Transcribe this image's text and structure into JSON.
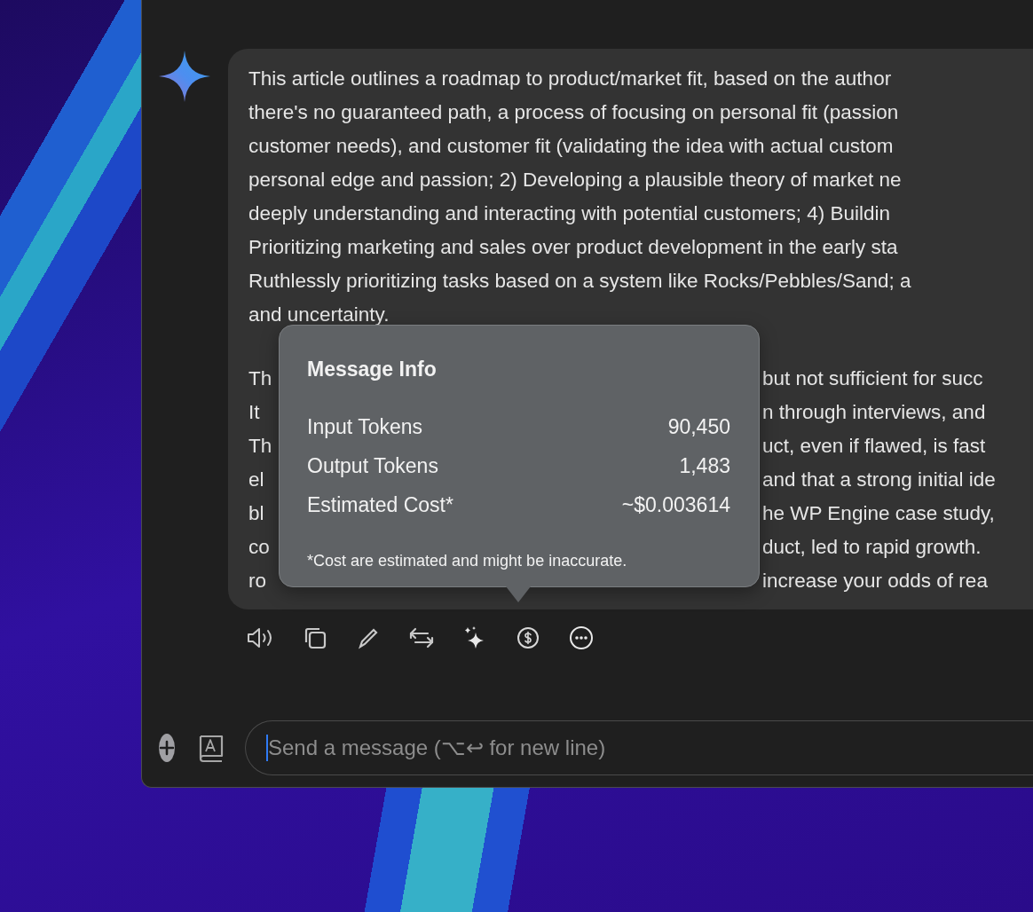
{
  "message": {
    "paragraphs": [
      {
        "lines": [
          {
            "text": "This article outlines a roadmap to product/market fit, based on the author"
          },
          {
            "text": "there's no guaranteed path, a process of focusing on personal fit (passion"
          },
          {
            "text": "customer needs), and customer fit (validating the idea with actual custom"
          },
          {
            "text": "personal edge and passion; 2) Developing a plausible theory of market ne"
          },
          {
            "text": "deeply understanding and interacting with potential customers; 4) Buildin"
          },
          {
            "text": "Prioritizing marketing and sales over product development in the early sta"
          },
          {
            "text": "Ruthlessly prioritizing tasks based on a system like Rocks/Pebbles/Sand; a"
          },
          {
            "text": "and uncertainty."
          }
        ]
      },
      {
        "lines": [
          {
            "left": "Th",
            "right": "but not sufficient for succ"
          },
          {
            "left": "It",
            "right": "n through interviews, and"
          },
          {
            "left": "Th",
            "right": "uct, even if flawed, is fast"
          },
          {
            "left": "el",
            "right": "and that a strong initial ide"
          },
          {
            "left": "bl",
            "right": "he WP Engine case study,"
          },
          {
            "left": "co",
            "right": "duct, led to rapid growth."
          },
          {
            "left": "ro",
            "right": "increase your odds of rea"
          }
        ]
      }
    ]
  },
  "message_info": {
    "title": "Message Info",
    "rows": [
      {
        "label": "Input Tokens",
        "value": "90,450"
      },
      {
        "label": "Output Tokens",
        "value": "1,483"
      },
      {
        "label": "Estimated Cost*",
        "value": "~$0.003614"
      }
    ],
    "footnote": "*Cost are estimated and might be inaccurate."
  },
  "composer": {
    "placeholder": "Send a message (⌥↩ for new line)",
    "focused": true
  }
}
